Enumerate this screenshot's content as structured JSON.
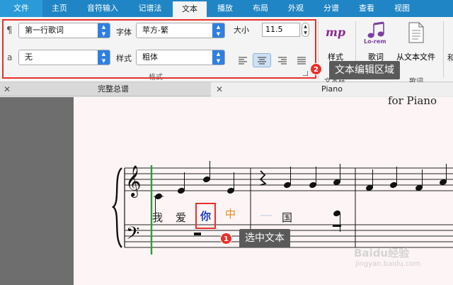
{
  "ribbon_tabs": [
    "文件",
    "主页",
    "音符输入",
    "记谱法",
    "文本",
    "播放",
    "布局",
    "外观",
    "分谱",
    "查看",
    "视图"
  ],
  "ribbon": {
    "style_dropdown": "第一行歌词",
    "font_label": "字体",
    "font_dropdown": "苹方-繁",
    "size_label": "大小",
    "size_value": "11.5",
    "row2_dropdown": "无",
    "style_label": "样式",
    "weight_dropdown": "粗体",
    "group_label": "格式",
    "styles_label": "样式",
    "mp_label": "mp",
    "lyrics_icon_text": "Lo-rem",
    "lyrics_label": "歌词",
    "from_text_file_label": "从文本文件",
    "left_glyph_top": "¶",
    "left_glyph_bottom": "a",
    "clipped_group_text": "和",
    "clipped_text_2": "文本样",
    "clipped_text_3": "歌词"
  },
  "callouts": {
    "c1_number": "1",
    "c1_text": "选中文本",
    "c2_number": "2",
    "c2_text": "文本编辑区域"
  },
  "doc_tabs": {
    "tab1": "完整总谱",
    "tab2": "Piano",
    "close_glyph": "✕"
  },
  "score": {
    "subtitle": "for Piano",
    "lyrics": [
      "我",
      "爱",
      "你",
      "中",
      "国"
    ],
    "lyric_colors": [
      "#222222",
      "#222222",
      "#1f3fbf",
      "#e08c1e",
      "#222222"
    ]
  },
  "watermark": {
    "line1": "Baidu经验",
    "line2": "jingyan.baidu.com"
  }
}
